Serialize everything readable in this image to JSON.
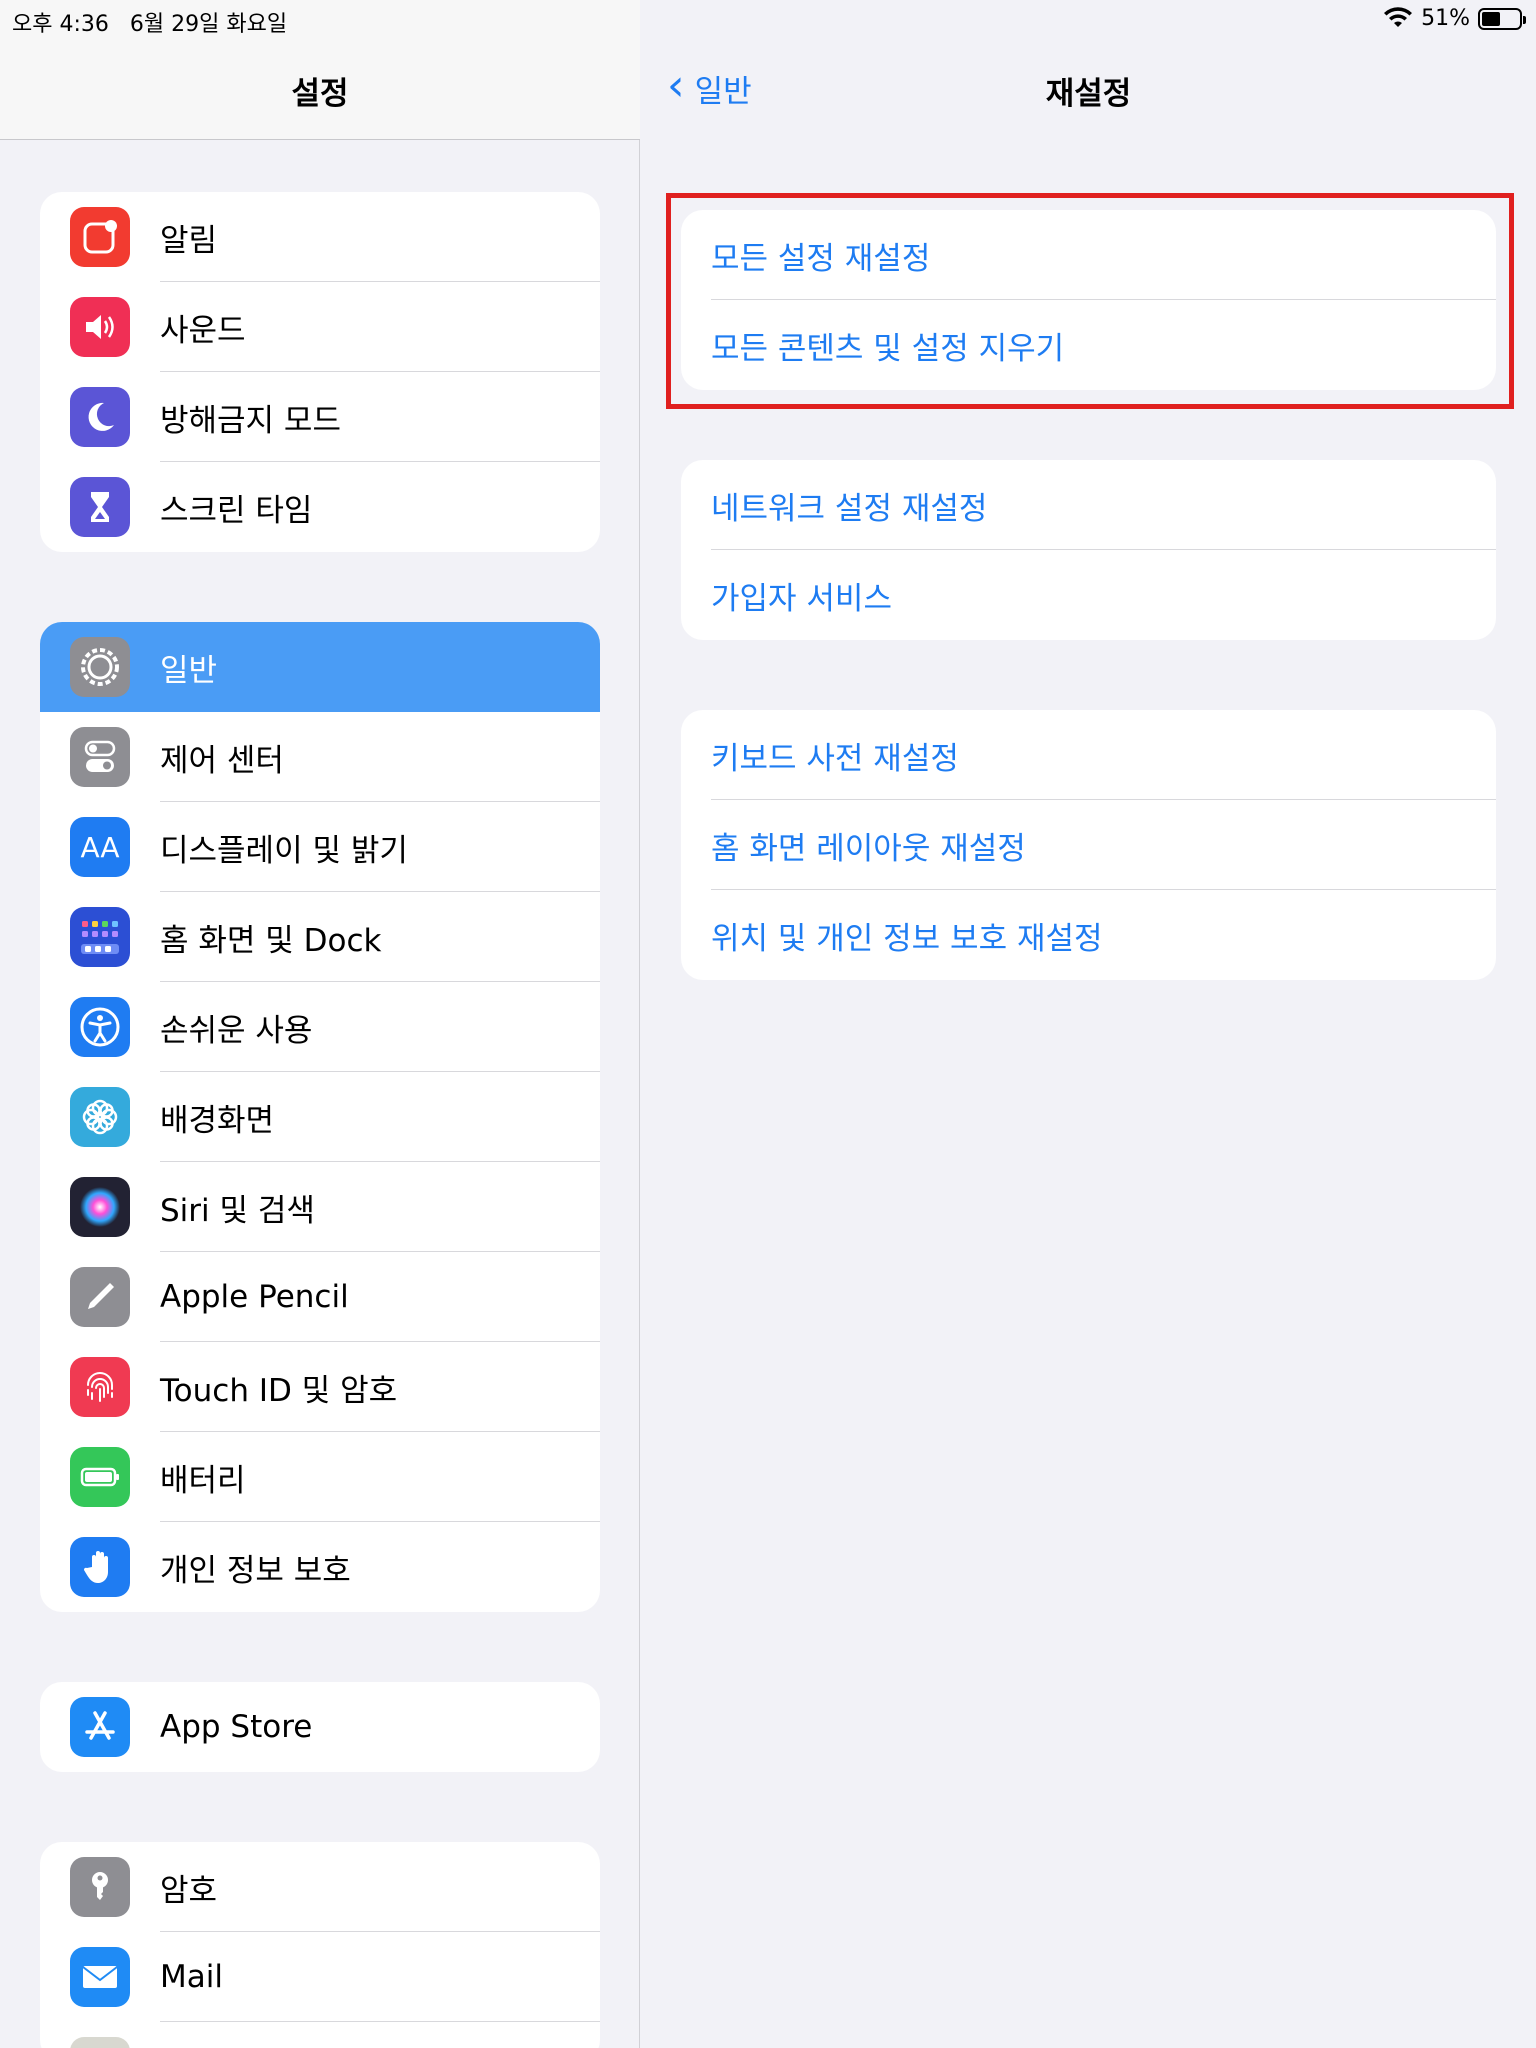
{
  "status": {
    "time": "오후 4:36",
    "date": "6월 29일 화요일",
    "battery": "51%",
    "battery_level": 0.51
  },
  "sidebar": {
    "title": "설정",
    "groups": [
      {
        "items": [
          {
            "label": "알림",
            "icon": "notification-icon",
            "color": "#f23b30"
          },
          {
            "label": "사운드",
            "icon": "speaker-icon",
            "color": "#f02f55"
          },
          {
            "label": "방해금지 모드",
            "icon": "moon-icon",
            "color": "#5b55d6"
          },
          {
            "label": "스크린 타임",
            "icon": "hourglass-icon",
            "color": "#5b55d6"
          }
        ]
      },
      {
        "items": [
          {
            "label": "일반",
            "icon": "gear-icon",
            "color": "#8e8e93",
            "selected": true
          },
          {
            "label": "제어 센터",
            "icon": "toggle-icon",
            "color": "#8e8e93"
          },
          {
            "label": "디스플레이 및 밝기",
            "icon": "text-size-icon",
            "color": "#1f7cf2"
          },
          {
            "label": "홈 화면 및 Dock",
            "icon": "home-grid-icon",
            "color": "#2c4fd4"
          },
          {
            "label": "손쉬운 사용",
            "icon": "accessibility-icon",
            "color": "#1f7cf2"
          },
          {
            "label": "배경화면",
            "icon": "flower-icon",
            "color": "#34aadc"
          },
          {
            "label": "Siri 및 검색",
            "icon": "siri-icon",
            "color": "#222233"
          },
          {
            "label": "Apple Pencil",
            "icon": "pencil-icon",
            "color": "#8e8e93"
          },
          {
            "label": "Touch ID 및 암호",
            "icon": "fingerprint-icon",
            "color": "#f03a52"
          },
          {
            "label": "배터리",
            "icon": "battery-icon",
            "color": "#34c759"
          },
          {
            "label": "개인 정보 보호",
            "icon": "hand-icon",
            "color": "#1f7cf2"
          }
        ]
      },
      {
        "items": [
          {
            "label": "App Store",
            "icon": "app-store-icon",
            "color": "#1f8bf5"
          }
        ]
      },
      {
        "items": [
          {
            "label": "암호",
            "icon": "key-icon",
            "color": "#8e8e93"
          },
          {
            "label": "Mail",
            "icon": "mail-icon",
            "color": "#1f8bf5"
          }
        ]
      }
    ]
  },
  "detail": {
    "back_label": "일반",
    "title": "재설정",
    "groups": [
      {
        "items": [
          "모든 설정 재설정",
          "모든 콘텐츠 및 설정 지우기"
        ]
      },
      {
        "items": [
          "네트워크 설정 재설정",
          "가입자 서비스"
        ]
      },
      {
        "items": [
          "키보드 사전 재설정",
          "홈 화면 레이아웃 재설정",
          "위치 및 개인 정보 보호 재설정"
        ]
      }
    ]
  }
}
